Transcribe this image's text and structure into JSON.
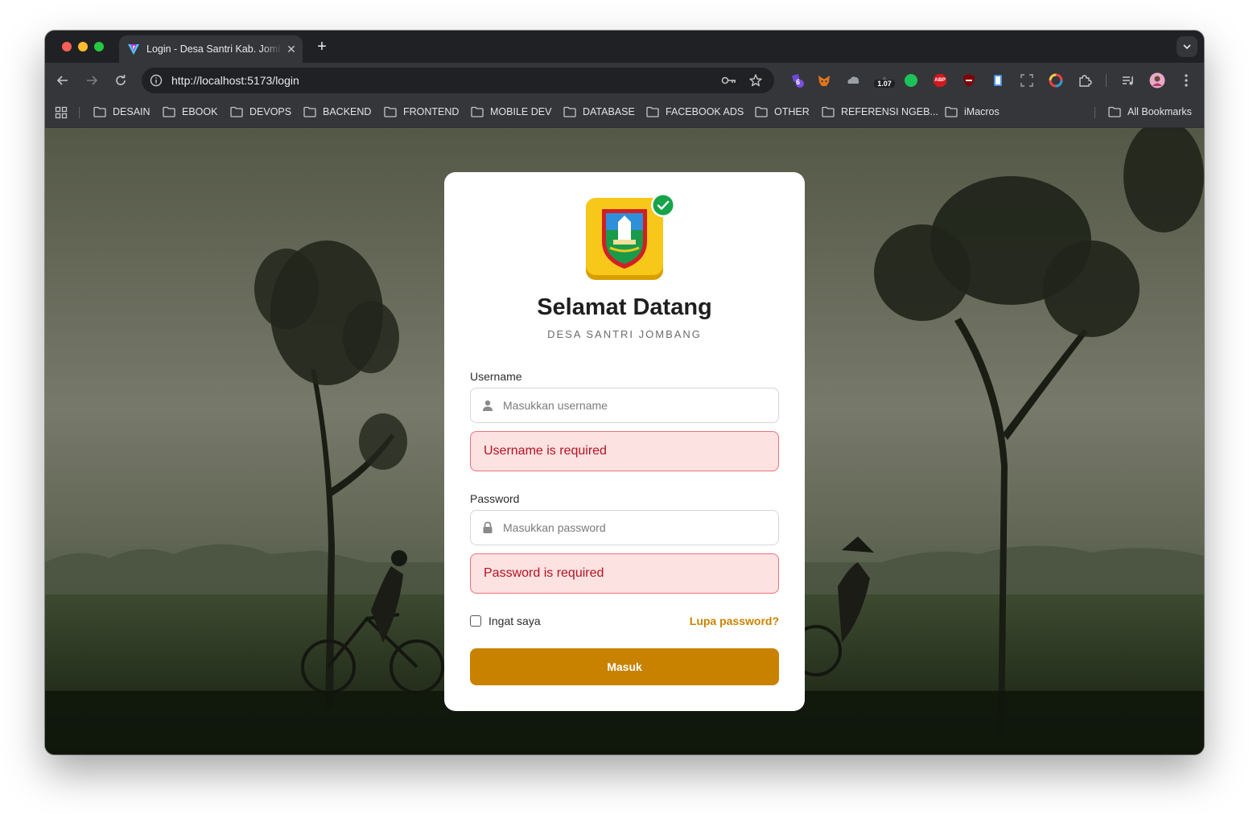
{
  "browser": {
    "tab_title": "Login - Desa Santri Kab. Jombang",
    "url": "http://localhost:5173/login",
    "extension_badges": {
      "purple": "6",
      "counter": "1.07",
      "abp": "ABP"
    }
  },
  "bookmarks": [
    "DESAIN",
    "EBOOK",
    "DEVOPS",
    "BACKEND",
    "FRONTEND",
    "MOBILE DEV",
    "DATABASE",
    "FACEBOOK ADS",
    "OTHER",
    "REFERENSI NGEB...",
    "iMacros"
  ],
  "all_bookmarks": "All Bookmarks",
  "login": {
    "title": "Selamat Datang",
    "subtitle": "DESA SANTRI JOMBANG",
    "username_label": "Username",
    "username_placeholder": "Masukkan username",
    "username_error": "Username is required",
    "password_label": "Password",
    "password_placeholder": "Masukkan password",
    "password_error": "Password is required",
    "remember_label": "Ingat saya",
    "forgot_label": "Lupa password?",
    "submit_label": "Masuk"
  },
  "colors": {
    "accent": "#c98200",
    "error_bg": "#fde2e2",
    "error_text": "#b3121f",
    "error_border": "#e9727a",
    "chrome_dark": "#202124",
    "chrome_toolbar": "#35363a"
  },
  "icons": {
    "username_field": "user-icon",
    "password_field": "lock-icon",
    "logo_badge": "check-icon"
  }
}
